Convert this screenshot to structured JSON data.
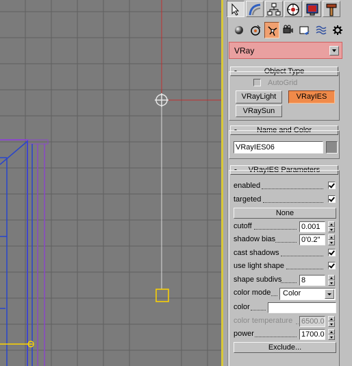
{
  "viewport": {
    "background": "#7b7b7b",
    "grid_color": "#5f5f5f",
    "light_color": "#e0e0e0",
    "selection_color": "#ffd400",
    "object_color": "#2844cc",
    "frame_color": "#8a48c8"
  },
  "command_panel": {
    "tabs": [
      {
        "name": "create-tab",
        "icon": "cursor-arrow-icon"
      },
      {
        "name": "modify-tab",
        "icon": "modify-curve-icon"
      },
      {
        "name": "hierarchy-tab",
        "icon": "hierarchy-icon"
      },
      {
        "name": "motion-tab",
        "icon": "motion-icon"
      },
      {
        "name": "display-tab",
        "icon": "display-icon"
      },
      {
        "name": "utilities-tab",
        "icon": "hammer-icon"
      }
    ],
    "categories": [
      {
        "name": "geometry",
        "icon": "sphere-icon"
      },
      {
        "name": "shapes",
        "icon": "shape-icon"
      },
      {
        "name": "lights",
        "icon": "light-icon",
        "active": true
      },
      {
        "name": "cameras",
        "icon": "camera-icon"
      },
      {
        "name": "helpers",
        "icon": "helper-icon"
      },
      {
        "name": "space-warps",
        "icon": "wave-icon"
      },
      {
        "name": "systems",
        "icon": "gear-icon"
      }
    ],
    "type_dropdown": "VRay"
  },
  "object_type": {
    "title": "Object Type",
    "autogrid": "AutoGrid",
    "buttons": [
      "VRayLight",
      "VRayIES",
      "VRaySun"
    ],
    "active_button": "VRayIES"
  },
  "name_color": {
    "title": "Name and Color",
    "name": "VRayIES06",
    "swatch": "#8a8a8a"
  },
  "params": {
    "title": "VRayIES Parameters",
    "enabled_label": "enabled",
    "targeted_label": "targeted",
    "none_button": "None",
    "cutoff_label": "cutoff",
    "cutoff_value": "0.001",
    "shadow_bias_label": "shadow bias",
    "shadow_bias_value": "0'0.2\"",
    "cast_shadows_label": "cast shadows",
    "use_light_shape_label": "use light shape",
    "shape_subdivs_label": "shape subdivs",
    "shape_subdivs_value": "8",
    "color_mode_label": "color mode",
    "color_mode_value": "Color",
    "color_label": "color",
    "color_swatch": "#ffffff",
    "color_temperature_label": "color temperature",
    "color_temperature_value": "6500.0",
    "power_label": "power",
    "power_value": "1700.0",
    "exclude_button": "Exclude..."
  }
}
